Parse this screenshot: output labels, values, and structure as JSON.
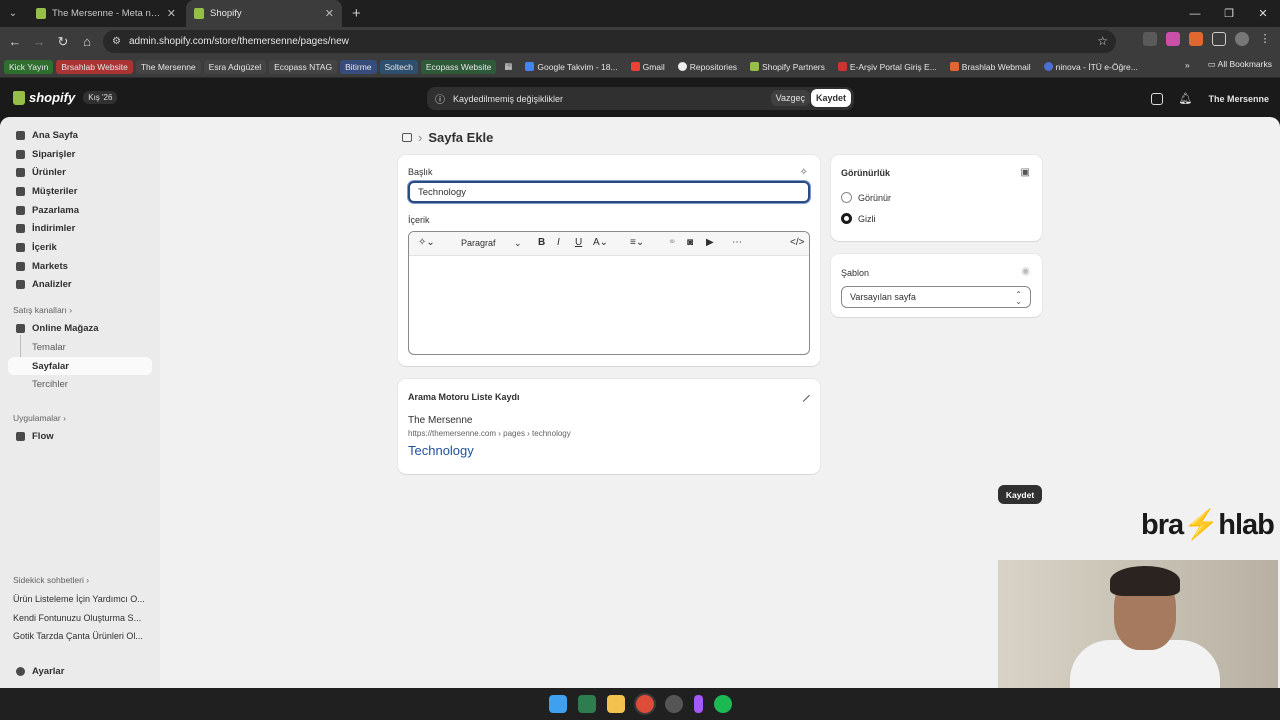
{
  "browser": {
    "tabs": [
      {
        "title": "The Mersenne - Meta nesne tanımları"
      },
      {
        "title": "Shopify"
      }
    ],
    "url": "admin.shopify.com/store/themersenne/pages/new",
    "bookmarks": [
      "Kick Yayın",
      "Brsahlab Website",
      "The Mersenne",
      "Esra Adıgüzel",
      "Ecopass NTAG",
      "Bitirme",
      "Soltech",
      "Ecopass Website",
      "Google Takvim - 18...",
      "Gmail",
      "Repositories",
      "Shopify Partners",
      "E-Arşiv Portal Giriş E...",
      "Brashlab Webmail",
      "ninova - İTÜ e-Öğre..."
    ],
    "all_bookmarks": "All Bookmarks"
  },
  "topbar": {
    "logo": "shopify",
    "badge": "Kış '26",
    "unsaved": "Kaydedilmemiş değişiklikler",
    "discard": "Vazgeç",
    "save": "Kaydet",
    "store": "The Mersenne"
  },
  "sidebar": {
    "items": [
      "Ana Sayfa",
      "Siparişler",
      "Ürünler",
      "Müşteriler",
      "Pazarlama",
      "İndirimler",
      "İçerik",
      "Markets",
      "Analizler"
    ],
    "sales_channels": "Satış kanalları",
    "online_store": "Online Mağaza",
    "sub": [
      "Temalar",
      "Sayfalar",
      "Tercihler"
    ],
    "apps": "Uygulamalar",
    "flow": "Flow",
    "sidekick": "Sidekick sohbetleri",
    "chats": [
      "Ürün Listeleme İçin Yardımcı O...",
      "Kendi Fontunuzu Oluşturma S...",
      "Gotik Tarzda Çanta Ürünleri Ol..."
    ],
    "settings": "Ayarlar"
  },
  "page": {
    "title": "Sayfa Ekle",
    "title_label": "Başlık",
    "title_value": "Technology",
    "content_label": "İçerik",
    "paragraph": "Paragraf",
    "visibility_title": "Görünürlük",
    "visible": "Görünür",
    "hidden": "Gizli",
    "visibility_selected": "hidden",
    "template_label": "Şablon",
    "template_value": "Varsayılan sayfa",
    "seo_title": "Arama Motoru Liste Kaydı",
    "seo_store": "The Mersenne",
    "seo_url": "https://themersenne.com › pages › technology",
    "seo_page_title": "Technology",
    "save_button": "Kaydet"
  },
  "watermark": "bra⚡hlab"
}
